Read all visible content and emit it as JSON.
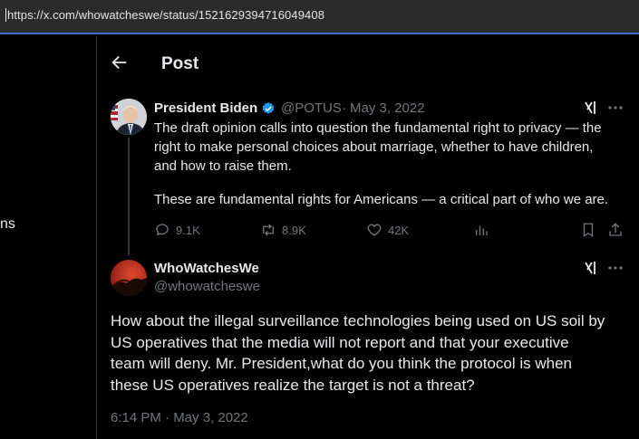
{
  "browser": {
    "url": "https://x.com/whowatcheswe/status/1521629394716049408"
  },
  "sidebar": {
    "partial_text": "ns"
  },
  "header": {
    "title": "Post"
  },
  "original_post": {
    "author_name": "President Biden",
    "handle": "@POTUS",
    "separator": "·",
    "date": "May 3, 2022",
    "lines": [
      "The draft opinion calls into question the fundamental right to privacy — the",
      "right to make personal choices about marriage, whether to have children,",
      "and how to raise them.",
      "These are fundamental rights for Americans — a critical part of who we are."
    ],
    "stats": {
      "replies": "9.1K",
      "reposts": "8.9K",
      "likes": "42K"
    }
  },
  "reply_post": {
    "author_name": "WhoWatchesWe",
    "handle": "@whowatcheswe",
    "lines": [
      "How about the illegal surveillance technologies being used on US soil by",
      "US operatives that the media will not report and that your executive",
      "team will deny. Mr. President,what do you think the protocol is when",
      "these US operatives realize the target is not a threat?"
    ],
    "timestamp": "6:14 PM · May 3, 2022"
  },
  "colors": {
    "background": "#000000",
    "text": "#e7e9ea",
    "muted": "#71767b",
    "verified": "#1d9bf0",
    "url_focus": "#3b6fd6"
  },
  "icons": [
    "back-arrow-icon",
    "verified-badge-icon",
    "grok-icon",
    "more-icon",
    "reply-icon",
    "repost-icon",
    "like-icon",
    "views-icon",
    "bookmark-icon",
    "share-icon"
  ]
}
